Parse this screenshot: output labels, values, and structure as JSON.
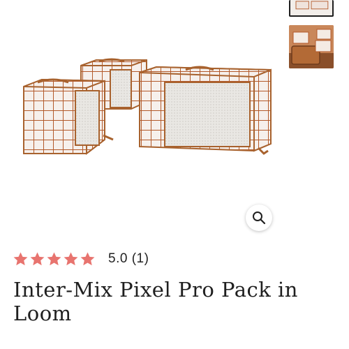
{
  "gallery": {
    "main_image_icon": "packing-cubes-image",
    "thumbnails": [
      "packing-cubes-thumbnail",
      "packing-cubes-lifestyle-thumbnail"
    ],
    "zoom_icon": "search-icon"
  },
  "product": {
    "rating_value": 5,
    "rating_max": 5,
    "rating_text": "5.0 (1)",
    "title": "Inter-Mix Pixel Pro Pack in Loom"
  },
  "colors": {
    "star": "#e8746f",
    "plaid": "#b35a2b",
    "trim": "#a8622e"
  }
}
